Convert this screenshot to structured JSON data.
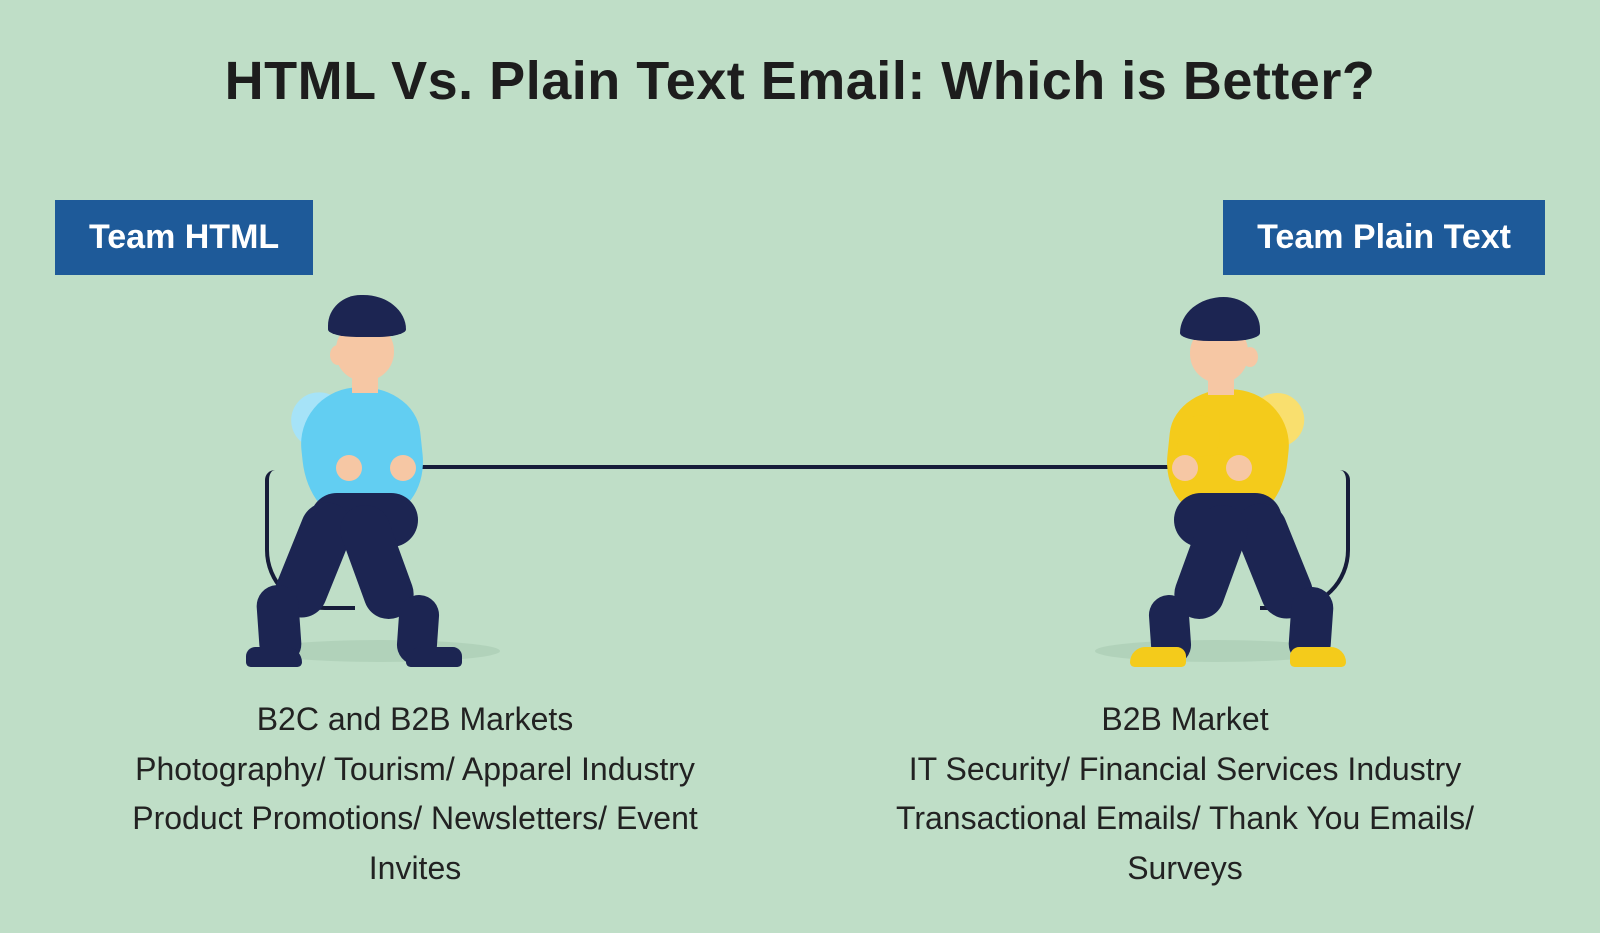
{
  "title": "HTML Vs. Plain Text Email: Which is Better?",
  "left": {
    "badge": "Team HTML",
    "lines": [
      "B2C and B2B Markets",
      "Photography/ Tourism/ Apparel Industry",
      "Product Promotions/ Newsletters/ Event Invites"
    ]
  },
  "right": {
    "badge": "Team Plain Text",
    "lines": [
      "B2B Market",
      "IT Security/ Financial Services Industry",
      "Transactional Emails/ Thank You Emails/ Surveys"
    ]
  },
  "colors": {
    "background": "#bfdec7",
    "badge": "#1e5a99",
    "shirtLeft": "#62cef2",
    "shirtRight": "#f4cb1b",
    "pants": "#1c2552"
  }
}
